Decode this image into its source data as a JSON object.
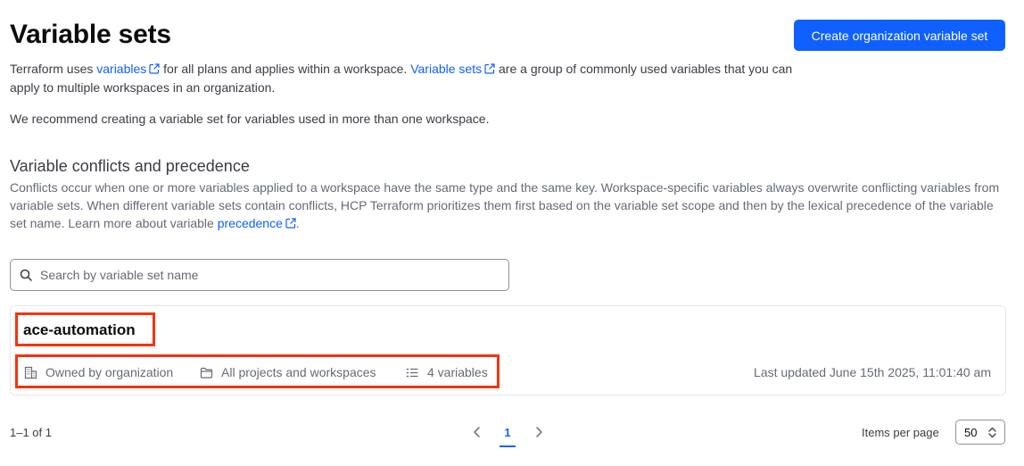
{
  "header": {
    "title": "Variable sets",
    "create_button": "Create organization variable set"
  },
  "intro": {
    "part1": "Terraform uses ",
    "link_variables": "variables",
    "part2": " for all plans and applies within a workspace. ",
    "link_variable_sets": "Variable sets",
    "part3": " are a group of commonly used variables that you can apply to multiple workspaces in an organization."
  },
  "recommendation": "We recommend creating a variable set for variables used in more than one workspace.",
  "conflicts": {
    "title": "Variable conflicts and precedence",
    "body": "Conflicts occur when one or more variables applied to a workspace have the same type and the same key. Workspace-specific variables always overwrite conflicting variables from variable sets. When different variable sets contain conflicts, HCP Terraform prioritizes them first based on the variable set scope and then by the lexical precedence of the variable set name. Learn more about variable ",
    "link_precedence": "precedence",
    "end": "."
  },
  "search": {
    "placeholder": "Search by variable set name"
  },
  "variable_sets": [
    {
      "name": "ace-automation",
      "owner": "Owned by organization",
      "scope": "All projects and workspaces",
      "count": "4 variables",
      "last_updated": "Last updated June 15th 2025, 11:01:40 am"
    }
  ],
  "pagination": {
    "range": "1–1 of 1",
    "current_page": "1",
    "items_per_page_label": "Items per page",
    "items_per_page_value": "50"
  },
  "colors": {
    "accent": "#1060ff",
    "highlight": "#f5330f"
  },
  "icons": [
    "external-link-icon",
    "search-icon",
    "building-icon",
    "folder-icon",
    "list-icon",
    "chevron-left-icon",
    "chevron-right-icon",
    "chevron-up-down-icon"
  ]
}
